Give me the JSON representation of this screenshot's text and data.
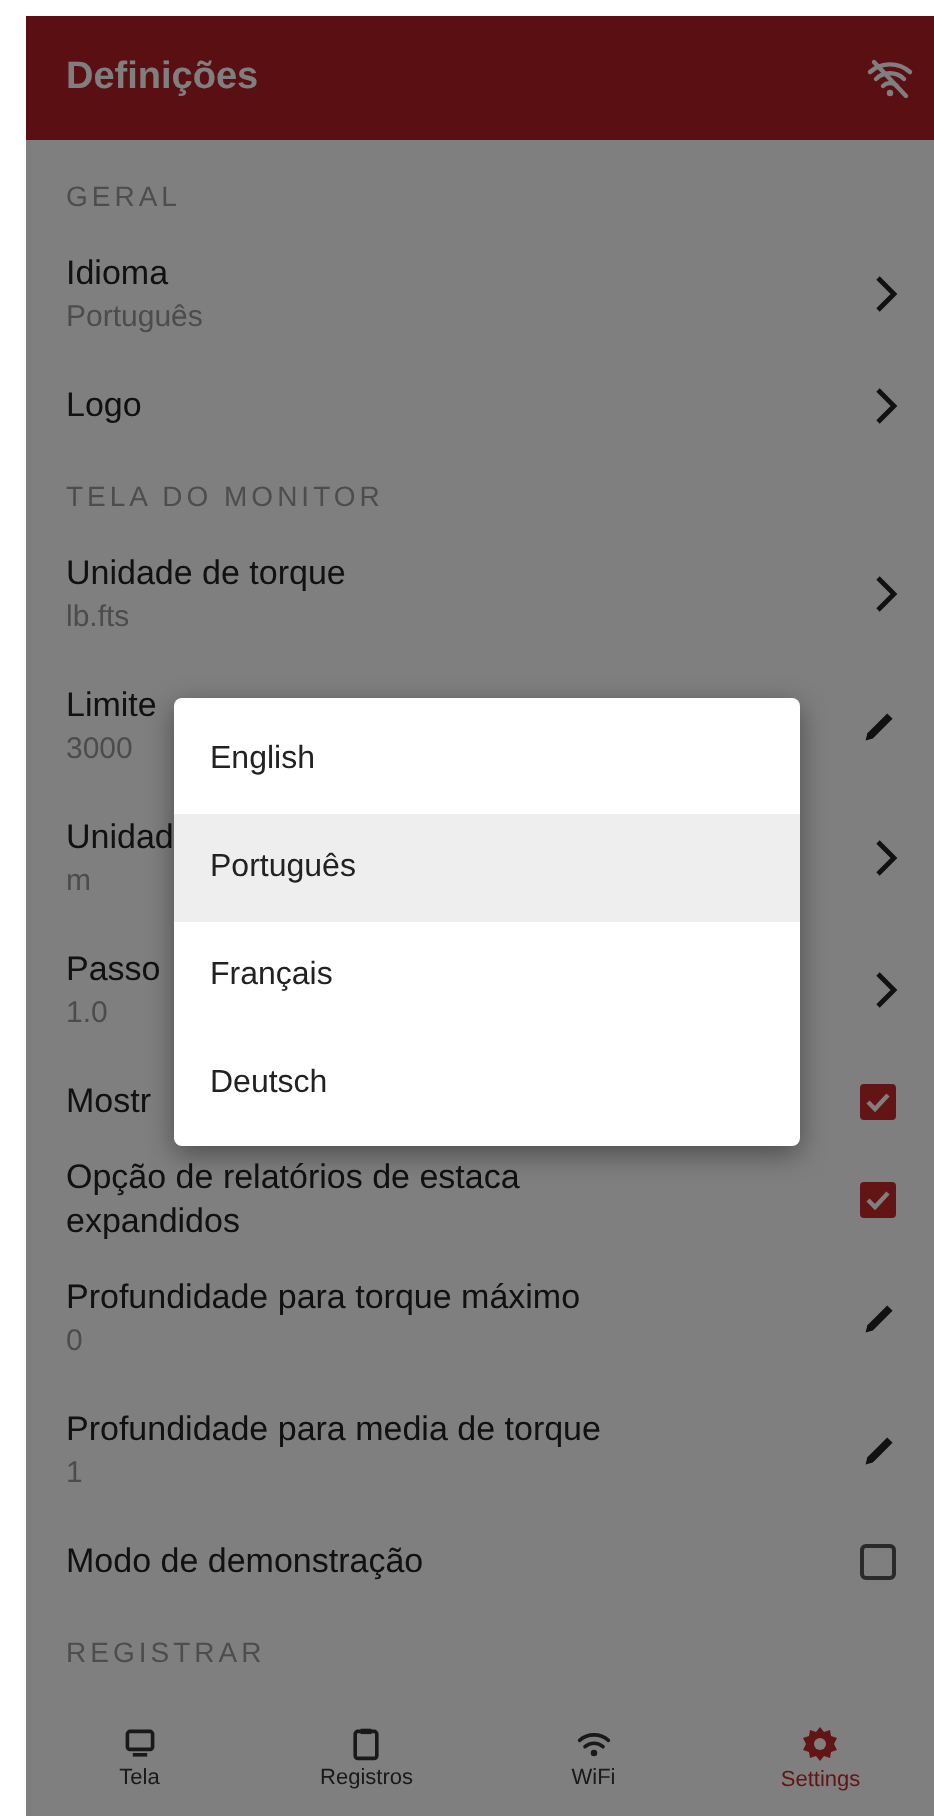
{
  "app_bar": {
    "title": "Definições"
  },
  "sections": [
    {
      "title": "GERAL",
      "rows": [
        {
          "kind": "nav",
          "label": "Idioma",
          "value": "Português"
        },
        {
          "kind": "nav",
          "label": "Logo"
        }
      ]
    },
    {
      "title": "TELA DO MONITOR",
      "rows": [
        {
          "kind": "nav",
          "label": "Unidade de torque",
          "value": "lb.fts"
        },
        {
          "kind": "edit",
          "label": "Limite",
          "value": "3000"
        },
        {
          "kind": "nav",
          "label": "Unidad",
          "value": "m"
        },
        {
          "kind": "nav",
          "label": "Passo",
          "value": "1.0"
        },
        {
          "kind": "check",
          "label": "Mostr",
          "checked": true
        },
        {
          "kind": "check",
          "label": "Opção de relatórios de estaca expandidos",
          "checked": true
        },
        {
          "kind": "edit",
          "label": "Profundidade para torque máximo",
          "value": "0"
        },
        {
          "kind": "edit",
          "label": "Profundidade para media de torque",
          "value": "1"
        },
        {
          "kind": "check",
          "label": "Modo de demonstração",
          "checked": false
        }
      ]
    },
    {
      "title": "REGISTRAR"
    }
  ],
  "language_menu": {
    "options": [
      {
        "label": "English",
        "selected": false
      },
      {
        "label": "Português",
        "selected": true
      },
      {
        "label": "Français",
        "selected": false
      },
      {
        "label": "Deutsch",
        "selected": false
      }
    ]
  },
  "bottom_nav": [
    {
      "kind": "monitor",
      "label": "Tela",
      "selected": false
    },
    {
      "kind": "clipboard",
      "label": "Registros",
      "selected": false
    },
    {
      "kind": "wifi",
      "label": "WiFi",
      "selected": false
    },
    {
      "kind": "gear",
      "label": "Settings",
      "selected": true
    }
  ]
}
